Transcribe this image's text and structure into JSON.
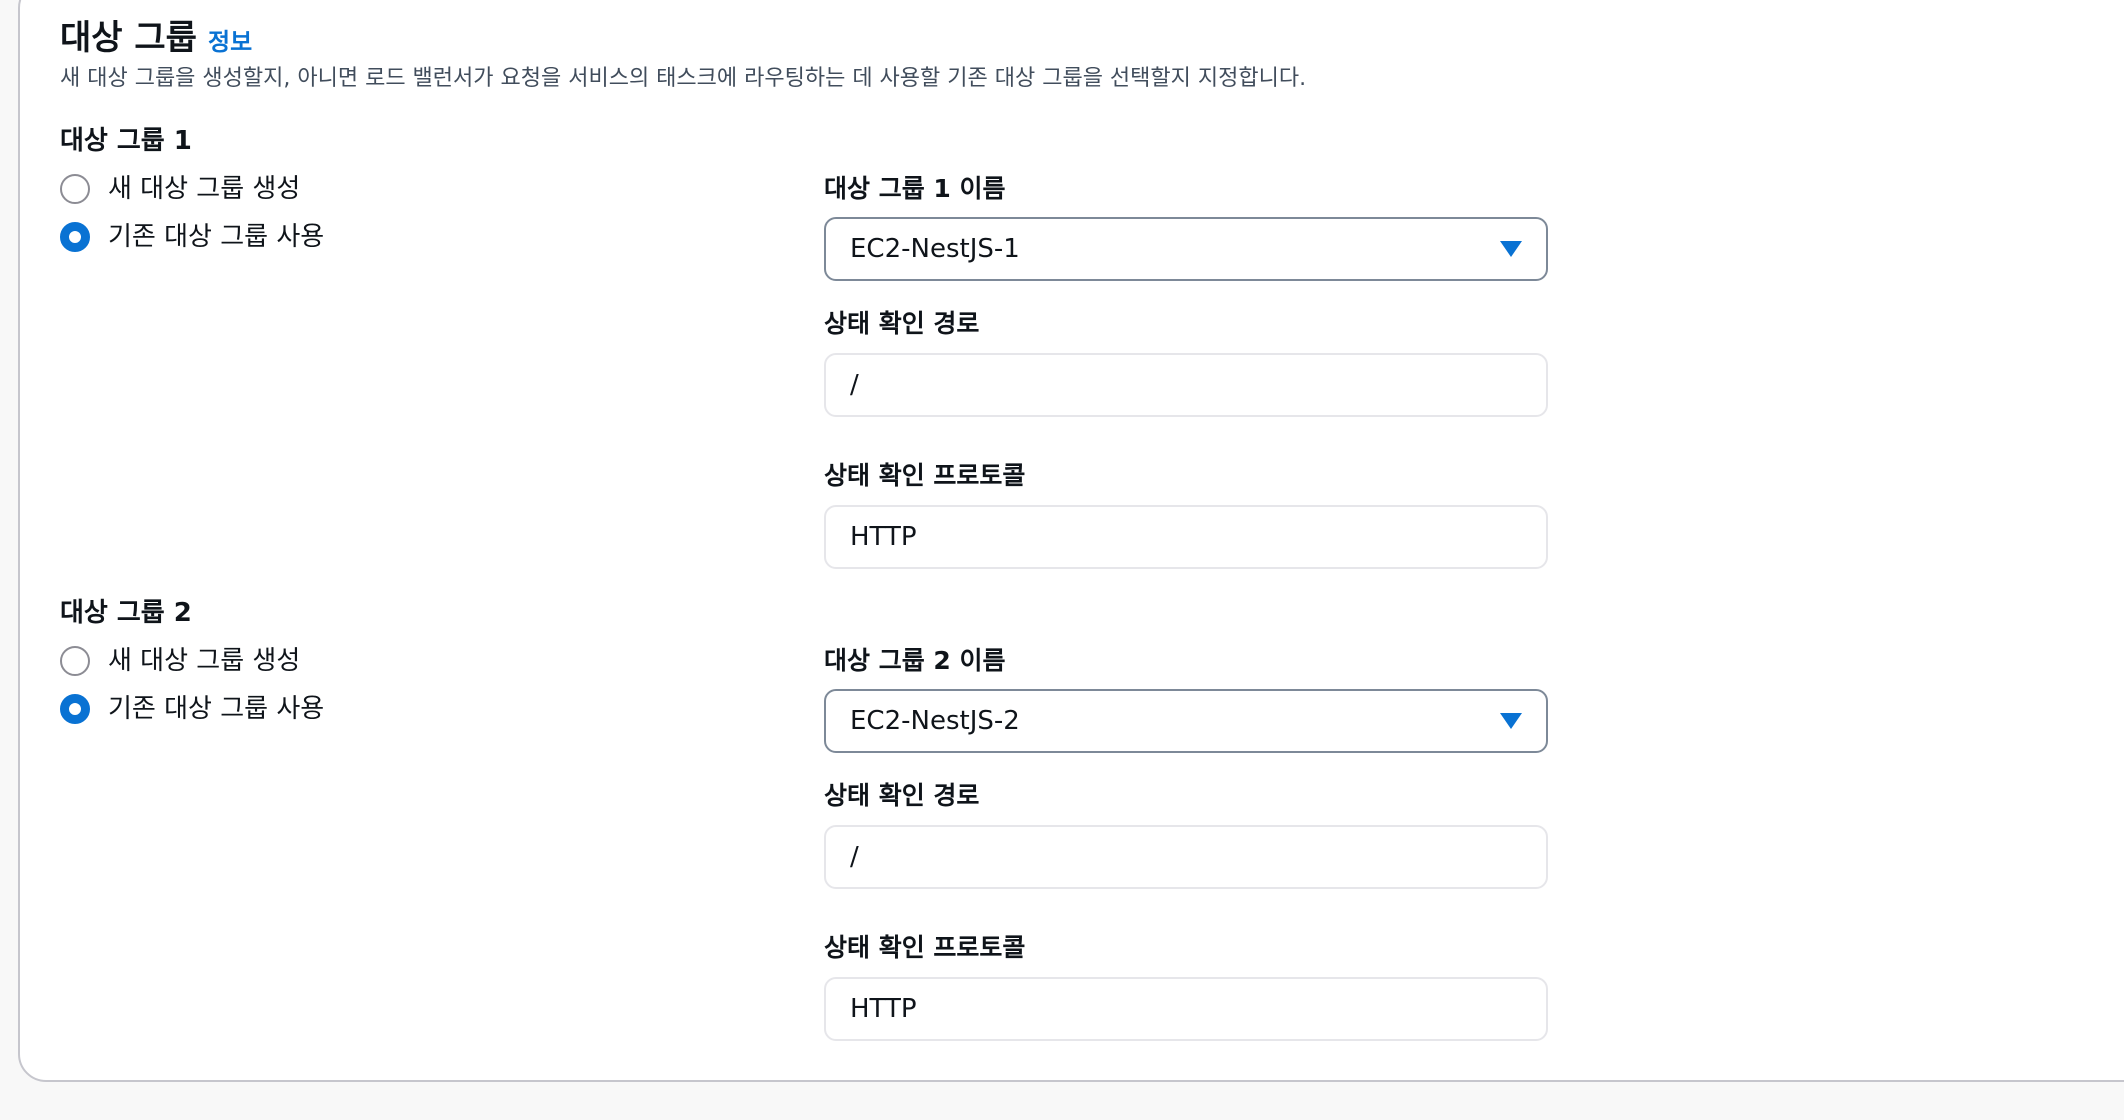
{
  "section": {
    "title": "대상 그룹",
    "info_link": "정보",
    "description": "새 대상 그룹을 생성할지, 아니면 로드 밸런서가 요청을 서비스의 태스크에 라우팅하는 데 사용할 기존 대상 그룹을 선택할지 지정합니다."
  },
  "groups": [
    {
      "label": "대상 그룹 1",
      "option_new": "새 대상 그룹 생성",
      "option_existing": "기존 대상 그룹 사용",
      "selected_option": "existing",
      "name_label": "대상 그룹 1 이름",
      "name_value": "EC2-NestJS-1",
      "health_path_label": "상태 확인 경로",
      "health_path_value": "/",
      "health_protocol_label": "상태 확인 프로토콜",
      "health_protocol_value": "HTTP"
    },
    {
      "label": "대상 그룹 2",
      "option_new": "새 대상 그룹 생성",
      "option_existing": "기존 대상 그룹 사용",
      "selected_option": "existing",
      "name_label": "대상 그룹 2 이름",
      "name_value": "EC2-NestJS-2",
      "health_path_label": "상태 확인 경로",
      "health_path_value": "/",
      "health_protocol_label": "상태 확인 프로토콜",
      "health_protocol_value": "HTTP"
    }
  ],
  "icons": {
    "dropdown": "caret-down-icon"
  },
  "colors": {
    "accent": "#0972d3",
    "text": "#0f141a",
    "muted_text": "#414d5c",
    "border": "#7d8998"
  }
}
